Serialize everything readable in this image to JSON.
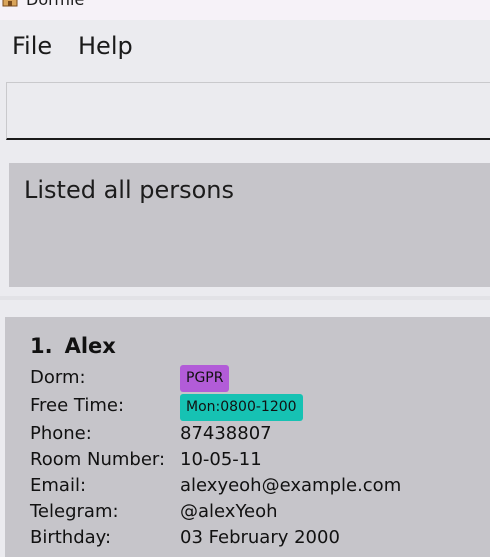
{
  "window": {
    "title": "Dormie"
  },
  "menu": {
    "items": [
      "File",
      "Help"
    ]
  },
  "command": {
    "value": "",
    "placeholder": ""
  },
  "result": {
    "message": "Listed all persons"
  },
  "persons": [
    {
      "index": "1.",
      "name": "Alex",
      "dorm_label": "Dorm:",
      "dorm": "PGPR",
      "free_time_label": "Free Time:",
      "free_time": "Mon:0800-1200",
      "phone_label": "Phone:",
      "phone": "87438807",
      "room_label": "Room Number:",
      "room": "10-05-11",
      "email_label": "Email:",
      "email": "alexyeoh@example.com",
      "telegram_label": "Telegram:",
      "telegram": "@alexYeoh",
      "birthday_label": "Birthday:",
      "birthday": "03 February 2000"
    }
  ],
  "colors": {
    "dorm_tag": "#b25cd8",
    "free_time_tag": "#16c2b3",
    "panel": "#c6c5ca",
    "background": "#ebebef"
  },
  "icons": {
    "app": "app-logo-icon"
  }
}
